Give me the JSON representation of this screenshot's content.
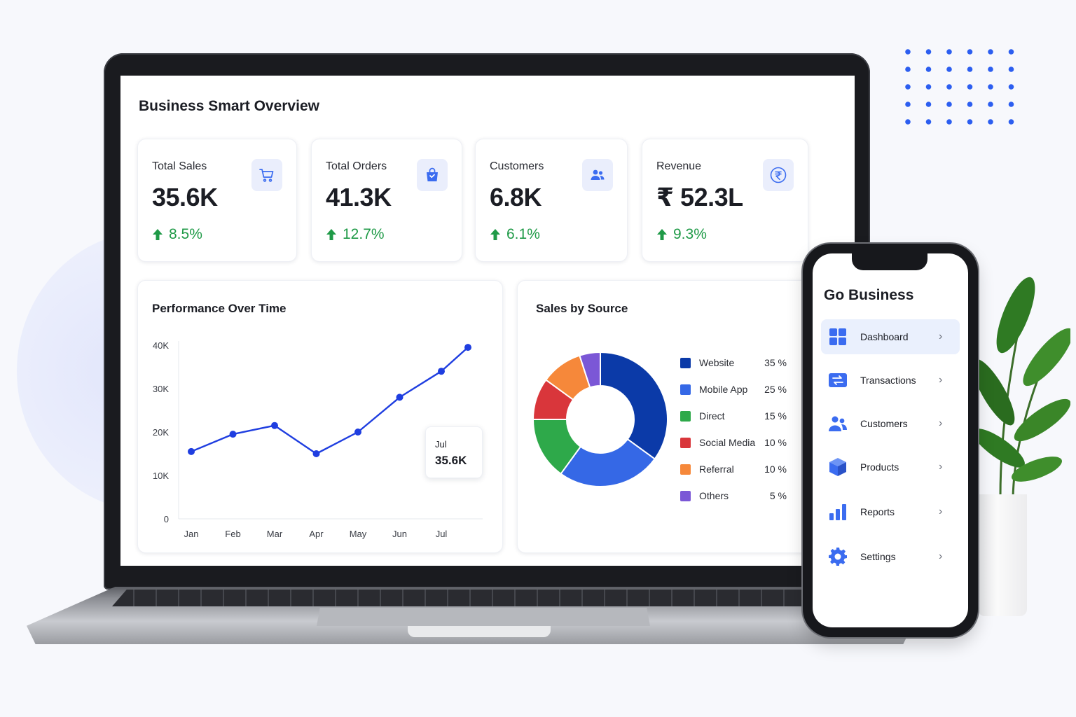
{
  "dashboard": {
    "title": "Business Smart Overview",
    "kpis": [
      {
        "label": "Total Sales",
        "value": "35.6K",
        "change": "8.5%",
        "icon": "cart-icon"
      },
      {
        "label": "Total Orders",
        "value": "41.3K",
        "change": "12.7%",
        "icon": "shopping-bag-icon"
      },
      {
        "label": "Customers",
        "value": "6.8K",
        "change": "6.1%",
        "icon": "users-icon"
      },
      {
        "label": "Revenue",
        "value": "₹ 52.3L",
        "change": "9.3%",
        "icon": "rupee-icon"
      }
    ],
    "performance": {
      "title": "Performance Over Time",
      "tooltip": {
        "month": "Jul",
        "value": "35.6K"
      }
    },
    "sales_by_source": {
      "title": "Sales by Source"
    }
  },
  "chart_data": [
    {
      "type": "line",
      "title": "Performance Over Time",
      "x": [
        "Jan",
        "Feb",
        "Mar",
        "Apr",
        "May",
        "Jun",
        "Jul"
      ],
      "series": [
        {
          "values": [
            15500,
            19500,
            21500,
            15000,
            20000,
            28000,
            34000,
            39500
          ]
        }
      ],
      "x_points": [
        "Jan",
        "Feb",
        "Mar",
        "Apr",
        "May",
        "Jun",
        "Jul",
        ""
      ],
      "yticks": [
        "0",
        "10K",
        "20K",
        "30K",
        "40K"
      ],
      "ylim": [
        0,
        40000
      ],
      "color": "#1f3ee0"
    },
    {
      "type": "pie",
      "title": "Sales by Source",
      "slices": [
        {
          "name": "Website",
          "value": 35,
          "label": "35 %",
          "color": "#0b3aa8"
        },
        {
          "name": "Mobile App",
          "value": 25,
          "label": "25 %",
          "color": "#3568e6"
        },
        {
          "name": "Direct",
          "value": 15,
          "label": "15 %",
          "color": "#2ea94a"
        },
        {
          "name": "Social Media",
          "value": 10,
          "label": "10 %",
          "color": "#d9363b"
        },
        {
          "name": "Referral",
          "value": 10,
          "label": "10 %",
          "color": "#f6883a"
        },
        {
          "name": "Others",
          "value": 5,
          "label": "5 %",
          "color": "#7b57d6"
        }
      ]
    }
  ],
  "phone": {
    "title": "Go Business",
    "nav": [
      {
        "label": "Dashboard",
        "icon": "grid-icon",
        "active": true
      },
      {
        "label": "Transactions",
        "icon": "transactions-icon",
        "active": false
      },
      {
        "label": "Customers",
        "icon": "users-icon",
        "active": false
      },
      {
        "label": "Products",
        "icon": "box-icon",
        "active": false
      },
      {
        "label": "Reports",
        "icon": "bar-chart-icon",
        "active": false
      },
      {
        "label": "Settings",
        "icon": "gear-icon",
        "active": false
      }
    ],
    "chevron": "›"
  },
  "colors": {
    "accent": "#3b6cf0",
    "positive": "#1f9a47"
  }
}
